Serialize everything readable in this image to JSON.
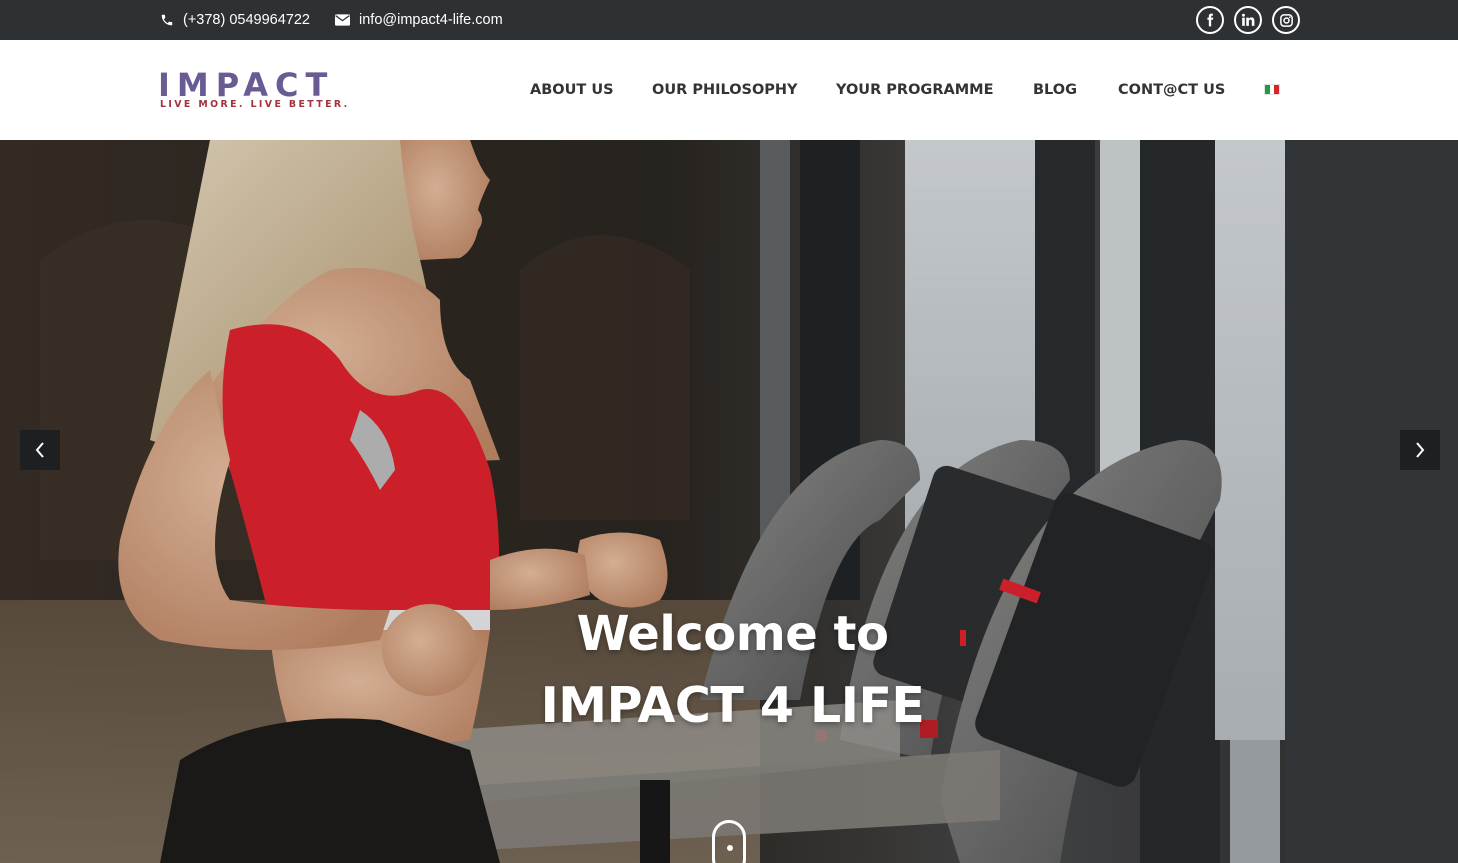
{
  "topbar": {
    "phone": {
      "icon": "phone-icon",
      "text": "(+378) 0549964722"
    },
    "email": {
      "icon": "envelope-icon",
      "text": "info@impact4-life.com"
    },
    "social": [
      "facebook-icon",
      "linkedin-icon",
      "instagram-icon"
    ]
  },
  "brand": {
    "logo_word": "IMPACT",
    "tagline": "LIVE MORE. LIVE BETTER.",
    "colors": {
      "word": "#6a5c93",
      "tagline": "#a2333d"
    }
  },
  "nav": {
    "items": [
      {
        "label": "ABOUT US"
      },
      {
        "label": "OUR PHILOSOPHY"
      },
      {
        "label": "YOUR PROGRAMME"
      },
      {
        "label": "BLOG"
      },
      {
        "label": "CONT@CT US"
      }
    ],
    "language_flag": "italian-flag-icon"
  },
  "hero": {
    "title_line1": "Welcome to",
    "title_line2": "IMPACT 4 LIFE",
    "prev_icon": "chevron-left-icon",
    "next_icon": "chevron-right-icon",
    "scroll_icon": "mouse-scroll-icon"
  },
  "colors": {
    "topbar_bg": "#2e3133",
    "nav_text": "#333333",
    "accent_red": "#e8252f"
  }
}
